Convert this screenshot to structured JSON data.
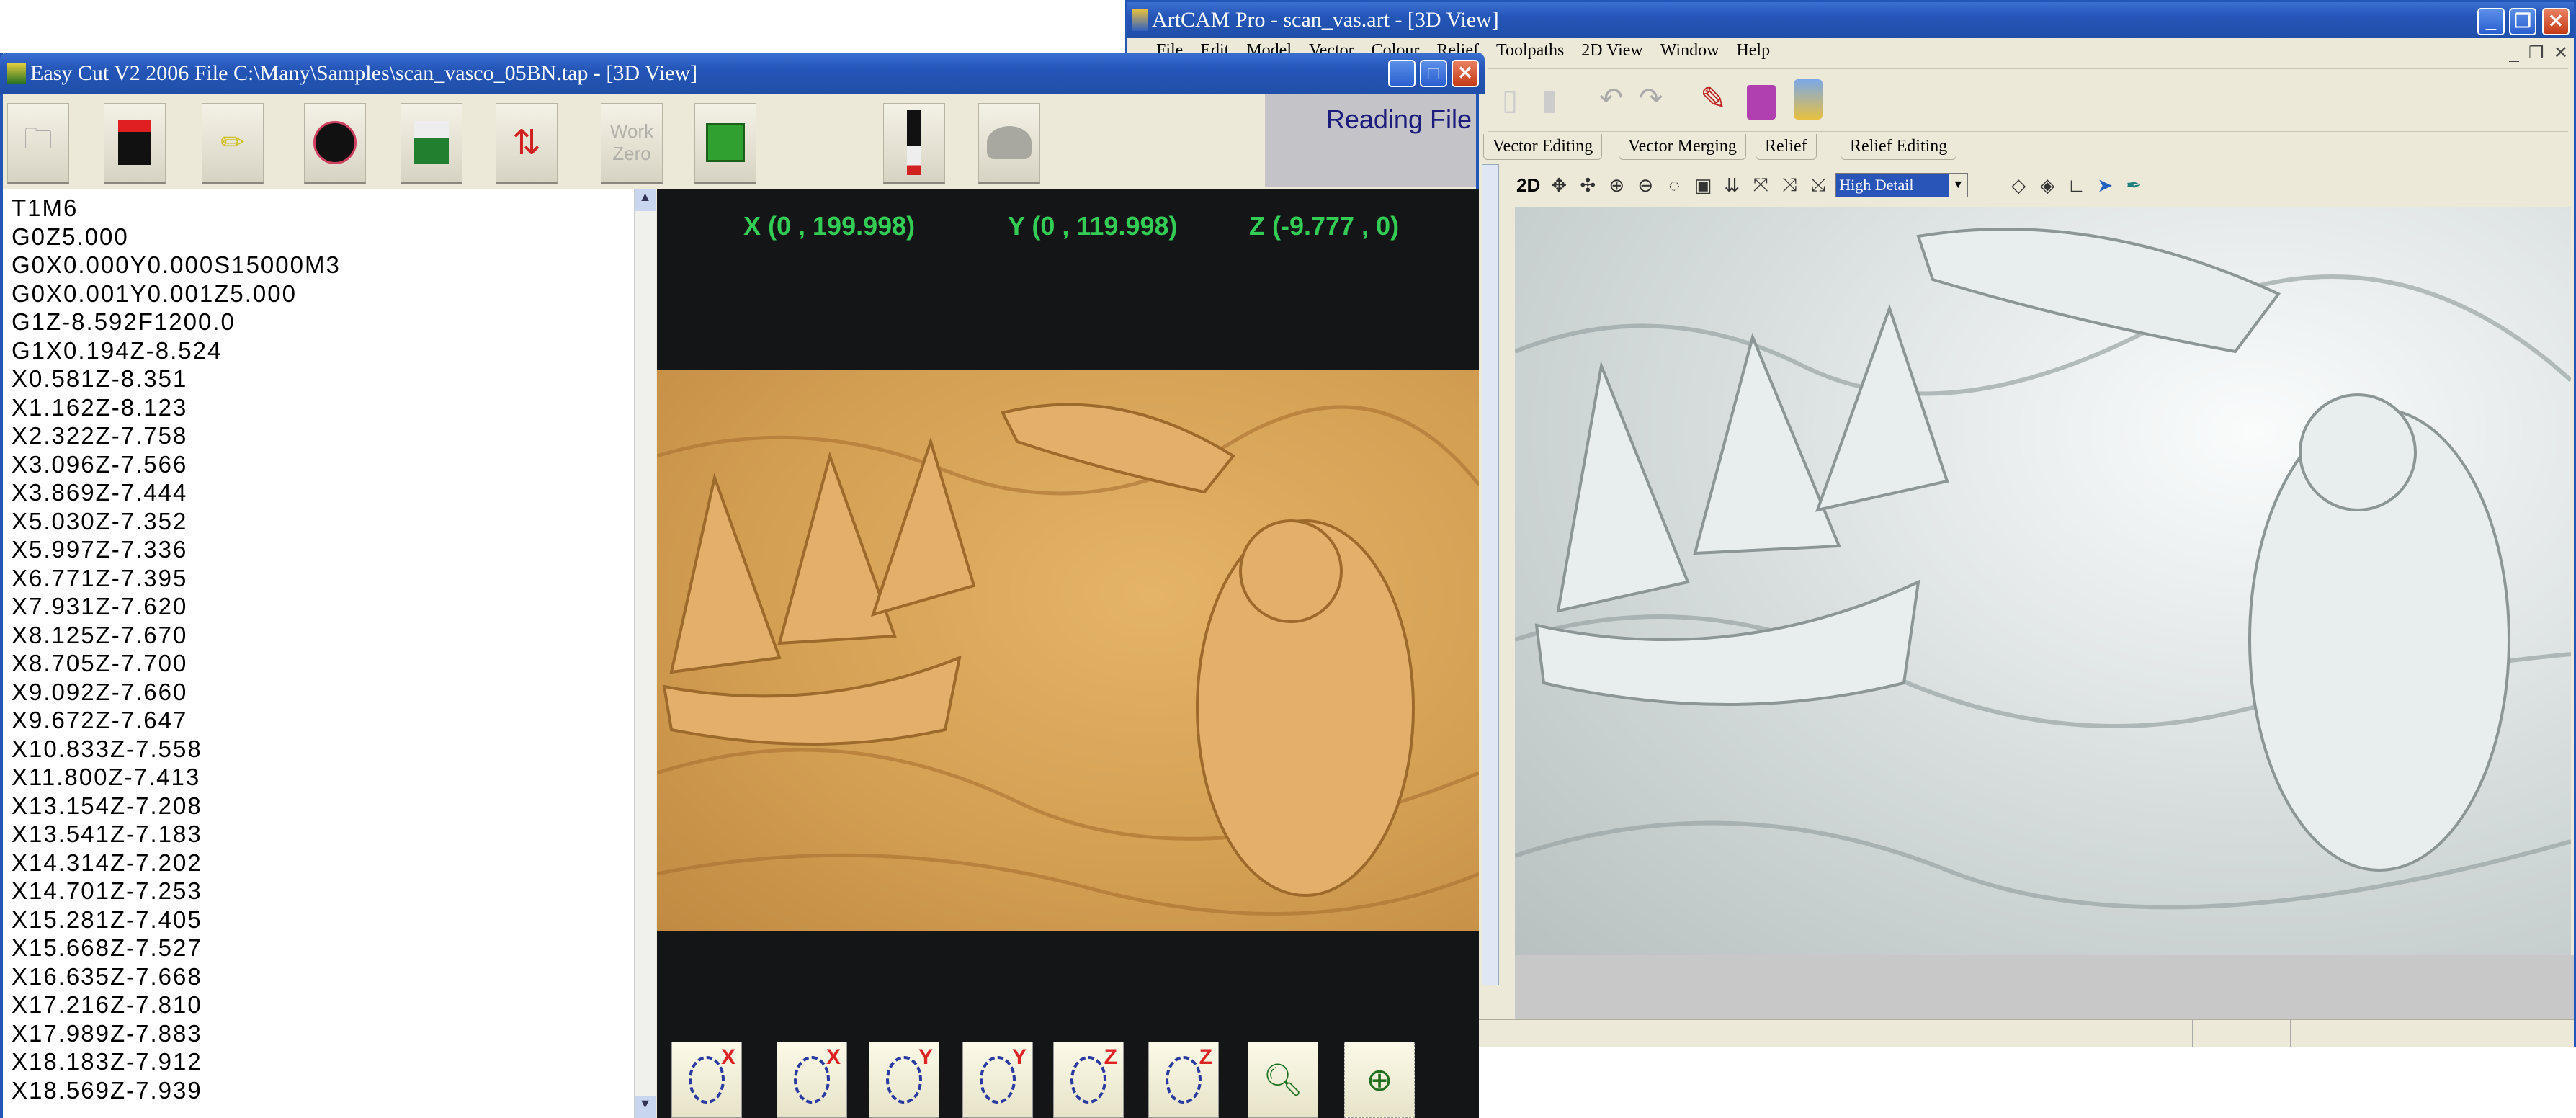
{
  "artcam": {
    "title": "ArtCAM Pro - scan_vas.art - [3D View]",
    "menu": [
      "File",
      "Edit",
      "Model",
      "Vector",
      "Colour",
      "Relief",
      "Toolpaths",
      "2D View",
      "Window",
      "Help"
    ],
    "tabs": [
      "Vector Editing",
      "Vector Merging",
      "Relief",
      "Relief Editing"
    ],
    "view_toolbar": {
      "mode_label": "2D",
      "detail_select": "High Detail"
    }
  },
  "easycut": {
    "title": "Easy Cut V2 2006 File C:\\Many\\Samples\\scan_vasco_05BN.tap - [3D View]",
    "toolbar": {
      "work_zero_label": "Work Zero",
      "status": "Reading File"
    },
    "coords": {
      "x": "X (0 , 199.998)",
      "y": "Y (0 , 119.998)",
      "z": "Z (-9.777 , 0)"
    },
    "code_lines": [
      "T1M6",
      "G0Z5.000",
      "G0X0.000Y0.000S15000M3",
      "G0X0.001Y0.001Z5.000",
      "G1Z-8.592F1200.0",
      "G1X0.194Z-8.524",
      "X0.581Z-8.351",
      "X1.162Z-8.123",
      "X2.322Z-7.758",
      "X3.096Z-7.566",
      "X3.869Z-7.444",
      "X5.030Z-7.352",
      "X5.997Z-7.336",
      "X6.771Z-7.395",
      "X7.931Z-7.620",
      "X8.125Z-7.670",
      "X8.705Z-7.700",
      "X9.092Z-7.660",
      "X9.672Z-7.647",
      "X10.833Z-7.558",
      "X11.800Z-7.413",
      "X13.154Z-7.208",
      "X13.541Z-7.183",
      "X14.314Z-7.202",
      "X14.701Z-7.253",
      "X15.281Z-7.405",
      "X15.668Z-7.527",
      "X16.635Z-7.668",
      "X17.216Z-7.810",
      "X17.989Z-7.883",
      "X18.183Z-7.912",
      "X18.569Z-7.939"
    ],
    "rotate_buttons": [
      {
        "axis": "X",
        "dir": "cw"
      },
      {
        "axis": "X",
        "dir": "ccw"
      },
      {
        "axis": "Y",
        "dir": "cw"
      },
      {
        "axis": "Y",
        "dir": "ccw"
      },
      {
        "axis": "Z",
        "dir": "cw"
      },
      {
        "axis": "Z",
        "dir": "ccw"
      }
    ]
  },
  "colors": {
    "coord_text": "#33cc55",
    "relief_wood": "#d9a55a",
    "status_text": "#1c1c7c",
    "axis_label": "#dd2222"
  }
}
